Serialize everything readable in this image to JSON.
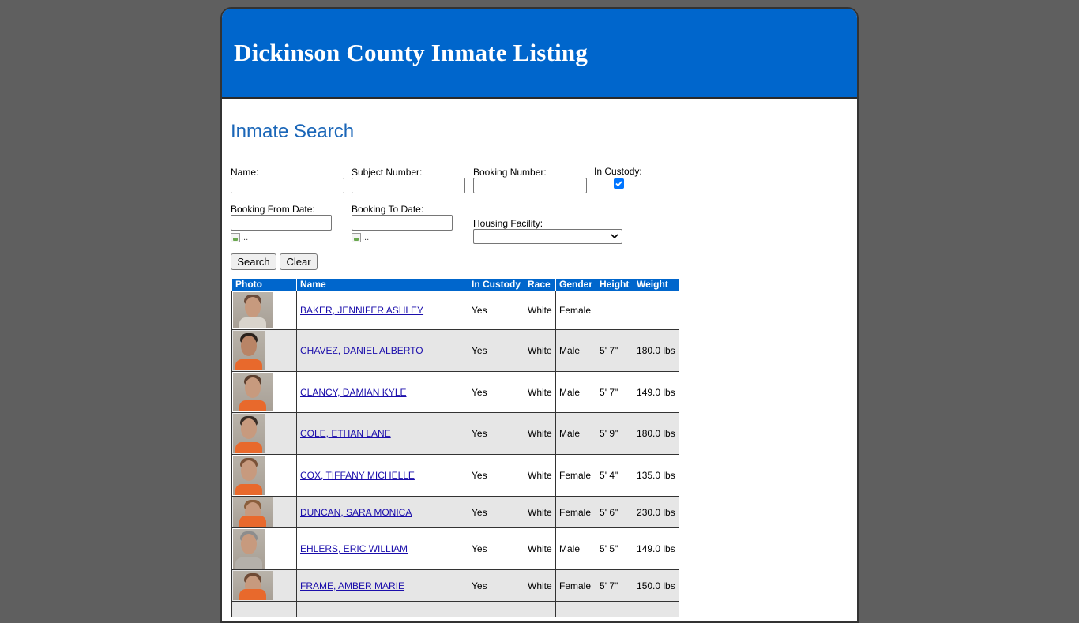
{
  "header": {
    "title": "Dickinson County Inmate Listing"
  },
  "search": {
    "heading": "Inmate Search",
    "name_label": "Name:",
    "subject_label": "Subject Number:",
    "booking_label": "Booking Number:",
    "custody_label": "In Custody:",
    "custody_checked": true,
    "from_label": "Booking From Date:",
    "to_label": "Booking To Date:",
    "facility_label": "Housing Facility:",
    "calendar_alt": "...",
    "search_button": "Search",
    "clear_button": "Clear"
  },
  "table": {
    "columns": [
      "Photo",
      "Name",
      "In Custody",
      "Race",
      "Gender",
      "Height",
      "Weight"
    ],
    "rows": [
      {
        "name": "BAKER, JENNIFER ASHLEY",
        "custody": "Yes",
        "race": "White",
        "gender": "Female",
        "height": "",
        "weight": ""
      },
      {
        "name": "CHAVEZ, DANIEL ALBERTO",
        "custody": "Yes",
        "race": "White",
        "gender": "Male",
        "height": "5' 7\"",
        "weight": "180.0 lbs"
      },
      {
        "name": "CLANCY, DAMIAN KYLE",
        "custody": "Yes",
        "race": "White",
        "gender": "Male",
        "height": "5' 7\"",
        "weight": "149.0 lbs"
      },
      {
        "name": "COLE, ETHAN LANE",
        "custody": "Yes",
        "race": "White",
        "gender": "Male",
        "height": "5' 9\"",
        "weight": "180.0 lbs"
      },
      {
        "name": "COX, TIFFANY MICHELLE",
        "custody": "Yes",
        "race": "White",
        "gender": "Female",
        "height": "5' 4\"",
        "weight": "135.0 lbs"
      },
      {
        "name": "DUNCAN, SARA MONICA",
        "custody": "Yes",
        "race": "White",
        "gender": "Female",
        "height": "5' 6\"",
        "weight": "230.0 lbs"
      },
      {
        "name": "EHLERS, ERIC WILLIAM",
        "custody": "Yes",
        "race": "White",
        "gender": "Male",
        "height": "5' 5\"",
        "weight": "149.0 lbs"
      },
      {
        "name": "FRAME, AMBER MARIE",
        "custody": "Yes",
        "race": "White",
        "gender": "Female",
        "height": "5' 7\"",
        "weight": "150.0 lbs"
      }
    ]
  },
  "colors": {
    "brand": "#0066cc",
    "background": "#5f5f5f",
    "alt_row": "#e6e6e6",
    "shirt": "#e8692c"
  }
}
